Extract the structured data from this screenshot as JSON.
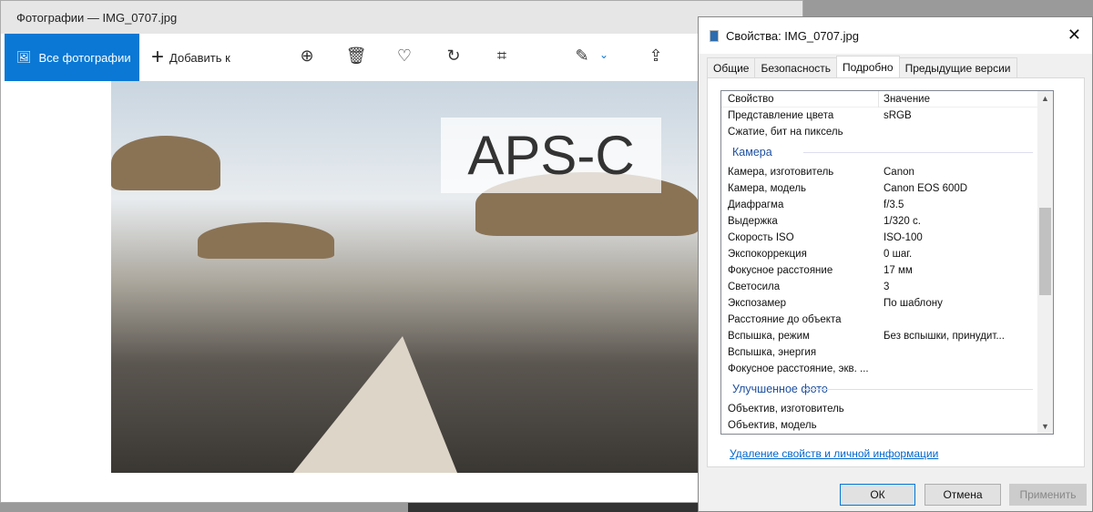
{
  "photos": {
    "title": "Фотографии — IMG_0707.jpg",
    "all_photos": "Все фотографии",
    "add_to": "Добавить к",
    "overlay": "APS-C"
  },
  "dialog": {
    "title": "Свойства: IMG_0707.jpg",
    "tabs": [
      "Общие",
      "Безопасность",
      "Подробно",
      "Предыдущие версии"
    ],
    "header": {
      "property": "Свойство",
      "value": "Значение"
    },
    "rows_top": [
      [
        "Представление цвета",
        "sRGB"
      ],
      [
        "Сжатие, бит на пиксель",
        ""
      ]
    ],
    "group_camera": "Камера",
    "rows_camera": [
      [
        "Камера, изготовитель",
        "Canon"
      ],
      [
        "Камера, модель",
        "Canon EOS 600D"
      ],
      [
        "Диафрагма",
        "f/3.5"
      ],
      [
        "Выдержка",
        "1/320 с."
      ],
      [
        "Скорость ISO",
        "ISO-100"
      ],
      [
        "Экспокоррекция",
        "0 шаг."
      ],
      [
        "Фокусное расстояние",
        "17 мм"
      ],
      [
        "Светосила",
        "3"
      ],
      [
        "Экспозамер",
        "По шаблону"
      ],
      [
        "Расстояние до объекта",
        ""
      ],
      [
        "Вспышка, режим",
        "Без вспышки, принудит..."
      ],
      [
        "Вспышка, энергия",
        ""
      ],
      [
        "Фокусное расстояние, экв. ...",
        ""
      ]
    ],
    "group_enhanced": "Улучшенное фото",
    "rows_enhanced": [
      [
        "Объектив, изготовитель",
        ""
      ],
      [
        "Объектив, модель",
        ""
      ]
    ],
    "link": "Удаление свойств и личной информации",
    "ok": "ОК",
    "cancel": "Отмена",
    "apply": "Применить"
  }
}
